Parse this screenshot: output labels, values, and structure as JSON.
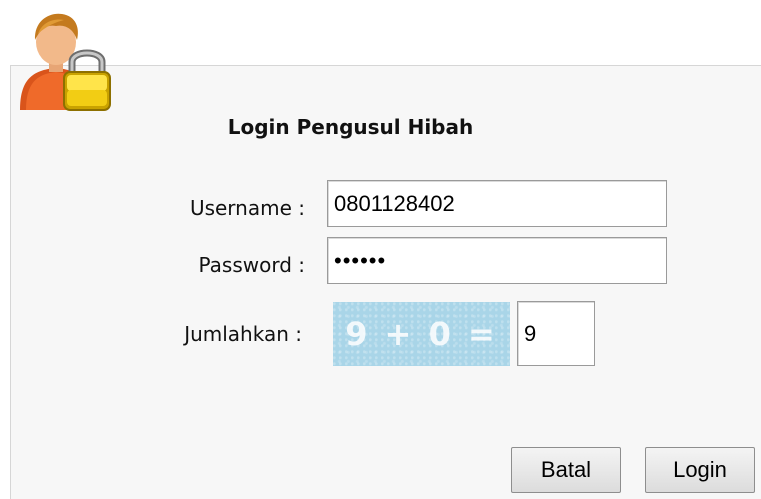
{
  "form": {
    "title": "Login Pengusul Hibah",
    "username_label": "Username :",
    "username_value": "0801128402",
    "password_label": "Password :",
    "password_value": "••••••",
    "captcha_label": "Jumlahkan :",
    "captcha_text": "9 + 0 =",
    "captcha_answer": "9"
  },
  "buttons": {
    "cancel_label": "Batal",
    "login_label": "Login"
  },
  "icon": {
    "name": "user-lock-icon"
  },
  "colors": {
    "captcha_bg": "#a9d5e8",
    "panel_bg": "#f7f7f7"
  }
}
